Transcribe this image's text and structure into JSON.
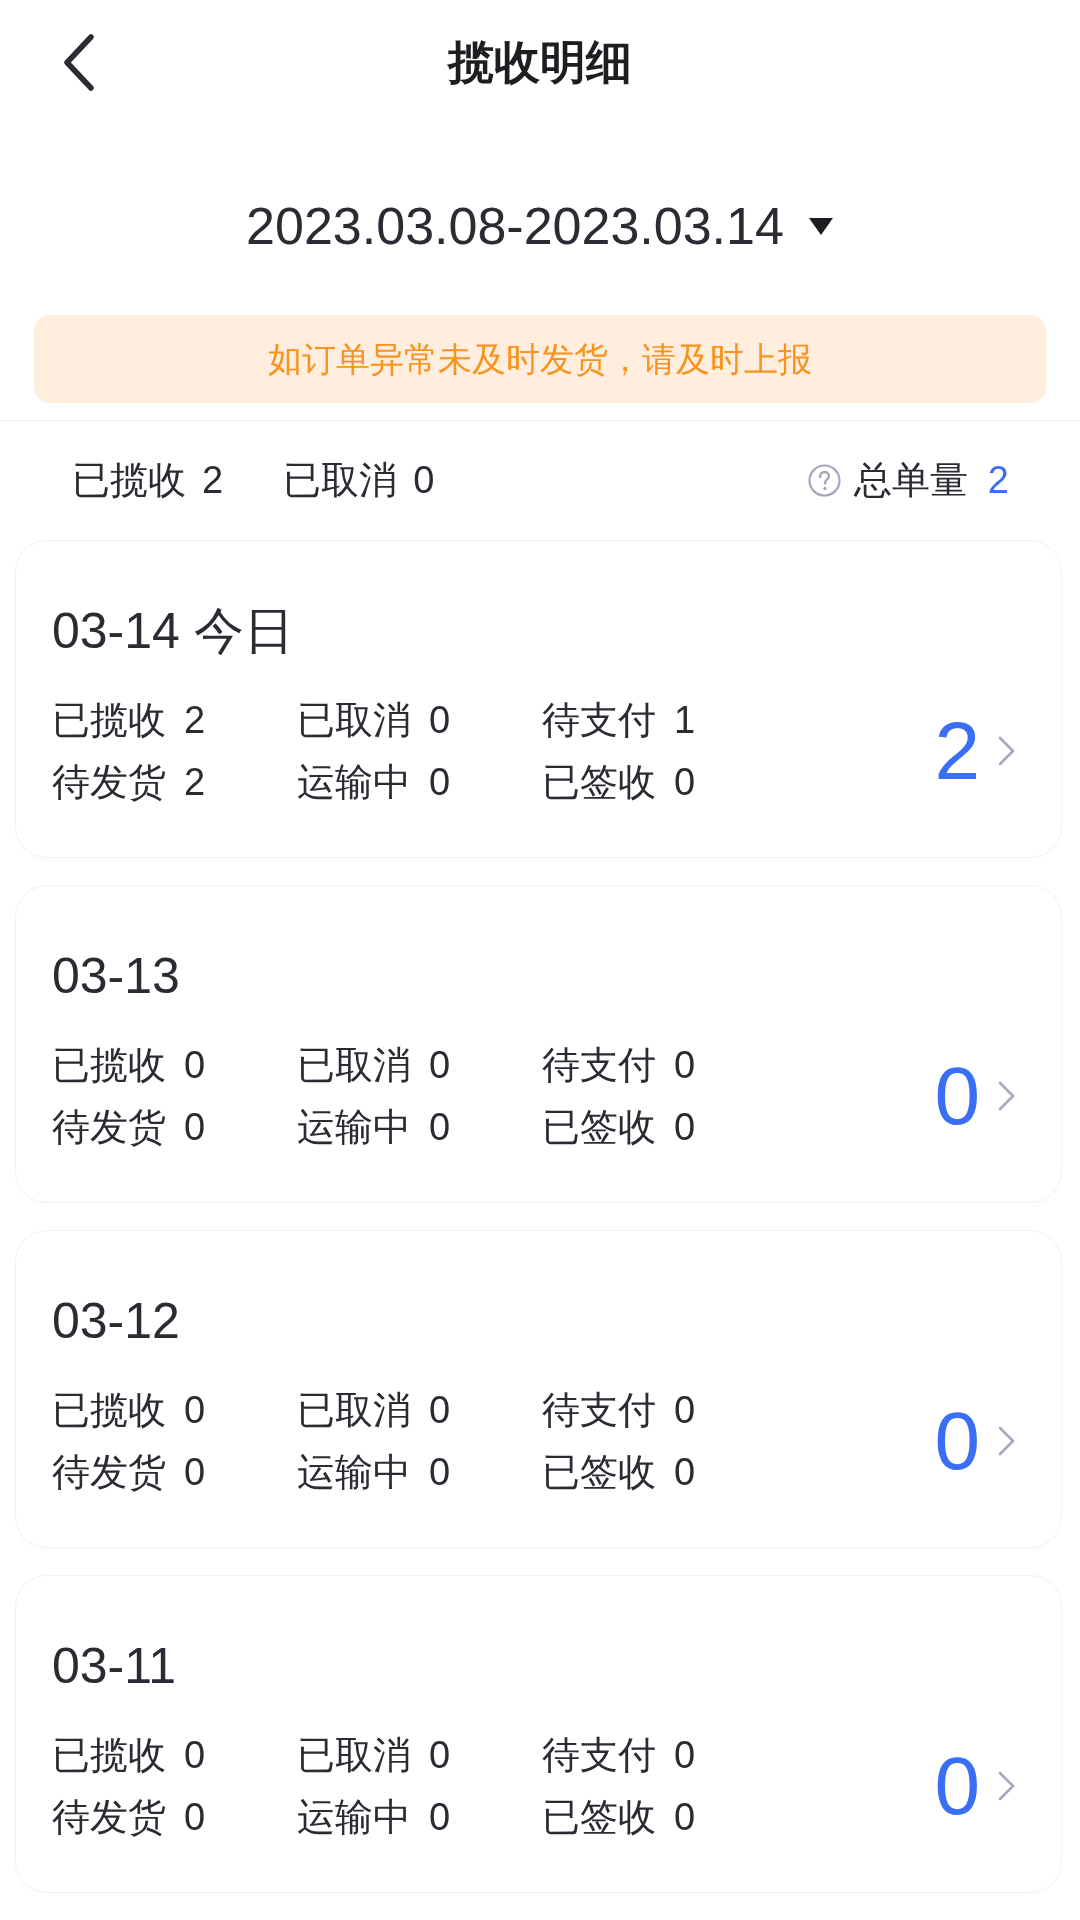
{
  "header": {
    "title": "揽收明细"
  },
  "date_range": {
    "label": "2023.03.08-2023.03.14"
  },
  "notice": {
    "text": "如订单异常未及时发货，请及时上报"
  },
  "summary": {
    "counts": [
      {
        "label": "已揽收",
        "value": "2"
      },
      {
        "label": "已取消",
        "value": "0"
      }
    ],
    "total": {
      "label": "总单量",
      "value": "2"
    }
  },
  "days": [
    {
      "date": "03-14 今日",
      "stats": [
        {
          "label": "已揽收",
          "value": "2"
        },
        {
          "label": "已取消",
          "value": "0"
        },
        {
          "label": "待支付",
          "value": "1"
        },
        {
          "label": "待发货",
          "value": "2"
        },
        {
          "label": "运输中",
          "value": "0"
        },
        {
          "label": "已签收",
          "value": "0"
        }
      ],
      "total": "2"
    },
    {
      "date": "03-13",
      "stats": [
        {
          "label": "已揽收",
          "value": "0"
        },
        {
          "label": "已取消",
          "value": "0"
        },
        {
          "label": "待支付",
          "value": "0"
        },
        {
          "label": "待发货",
          "value": "0"
        },
        {
          "label": "运输中",
          "value": "0"
        },
        {
          "label": "已签收",
          "value": "0"
        }
      ],
      "total": "0"
    },
    {
      "date": "03-12",
      "stats": [
        {
          "label": "已揽收",
          "value": "0"
        },
        {
          "label": "已取消",
          "value": "0"
        },
        {
          "label": "待支付",
          "value": "0"
        },
        {
          "label": "待发货",
          "value": "0"
        },
        {
          "label": "运输中",
          "value": "0"
        },
        {
          "label": "已签收",
          "value": "0"
        }
      ],
      "total": "0"
    },
    {
      "date": "03-11",
      "stats": [
        {
          "label": "已揽收",
          "value": "0"
        },
        {
          "label": "已取消",
          "value": "0"
        },
        {
          "label": "待支付",
          "value": "0"
        },
        {
          "label": "待发货",
          "value": "0"
        },
        {
          "label": "运输中",
          "value": "0"
        },
        {
          "label": "已签收",
          "value": "0"
        }
      ],
      "total": "0"
    }
  ]
}
